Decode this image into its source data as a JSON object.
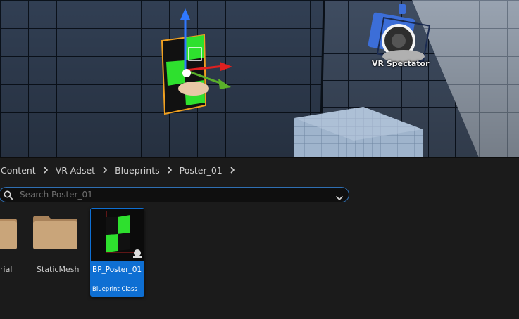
{
  "viewport": {
    "actor_label": "VR Spectator"
  },
  "breadcrumb": {
    "items": [
      "Content",
      "VR-Adset",
      "Blueprints",
      "Poster_01"
    ]
  },
  "search": {
    "placeholder": "Search Poster_01",
    "value": ""
  },
  "assets": {
    "folders": [
      {
        "name": "rial",
        "type": "folder"
      },
      {
        "name": "StaticMesh",
        "type": "folder"
      }
    ],
    "selected": {
      "name": "BP_Poster_01",
      "type_label": "Blueprint Class"
    }
  },
  "colors": {
    "selection": "#0e6fd3",
    "search_border": "#2f6fb3",
    "folder": "#c9a57a"
  }
}
